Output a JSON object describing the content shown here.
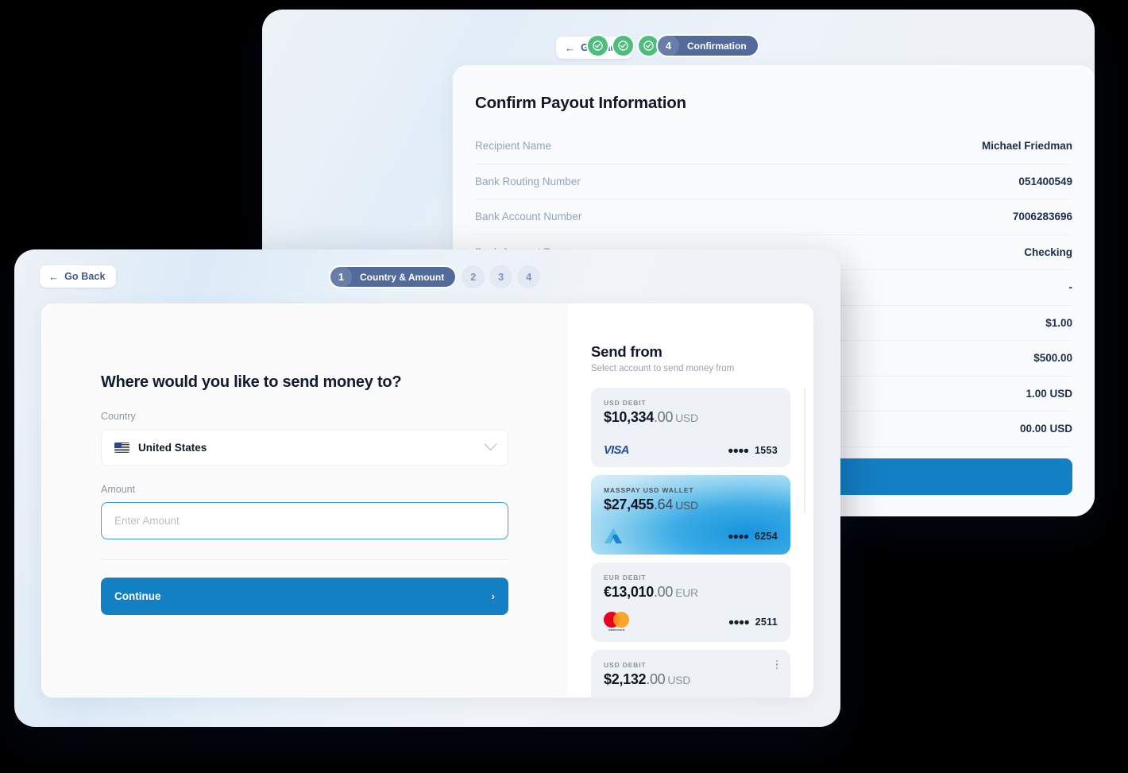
{
  "back_panel": {
    "go_back_label": "Go Back",
    "steps": [
      {
        "num": "1",
        "state": "done",
        "label": ""
      },
      {
        "num": "2",
        "state": "done",
        "label": ""
      },
      {
        "num": "3",
        "state": "done",
        "label": ""
      },
      {
        "num": "4",
        "state": "active",
        "label": "Confirmation"
      }
    ],
    "card_title": "Confirm Payout Information",
    "rows": [
      {
        "key": "Recipient Name",
        "value": "Michael Friedman"
      },
      {
        "key": "Bank Routing Number",
        "value": "051400549"
      },
      {
        "key": "Bank Account Number",
        "value": "7006283696"
      },
      {
        "key": "Bank Account Type",
        "value": "Checking"
      },
      {
        "key": "",
        "value": "-"
      },
      {
        "key": "",
        "value": "$1.00"
      },
      {
        "key": "",
        "value": "$500.00"
      },
      {
        "key": "",
        "value": "1.00 USD"
      },
      {
        "key": "",
        "value": "00.00 USD"
      }
    ]
  },
  "front_panel": {
    "go_back_label": "Go Back",
    "steps": [
      {
        "num": "1",
        "state": "active",
        "label": "Country & Amount"
      },
      {
        "num": "2",
        "state": "idle",
        "label": ""
      },
      {
        "num": "3",
        "state": "idle",
        "label": ""
      },
      {
        "num": "4",
        "state": "idle",
        "label": ""
      }
    ],
    "form": {
      "title": "Where would you like to send money to?",
      "country_label": "Country",
      "country_value": "United States",
      "country_flag": "flag-us-icon",
      "amount_label": "Amount",
      "amount_value": "",
      "amount_placeholder": "Enter Amount",
      "continue_label": "Continue"
    },
    "send_from": {
      "title": "Send from",
      "subtitle": "Select account to send money from",
      "accounts": [
        {
          "type": "USD DEBIT",
          "amount_major": "$10,334",
          "amount_minor": ".00",
          "currency": "USD",
          "brand": "visa",
          "last4": "1553",
          "selected": false,
          "has_menu": false
        },
        {
          "type": "MASSPAY USD WALLET",
          "amount_major": "$27,455",
          "amount_minor": ".64",
          "currency": "USD",
          "brand": "masspay",
          "last4": "6254",
          "selected": true,
          "has_menu": false
        },
        {
          "type": "EUR DEBIT",
          "amount_major": "€13,010",
          "amount_minor": ".00",
          "currency": "EUR",
          "brand": "mastercard",
          "last4": "2511",
          "selected": false,
          "has_menu": false
        },
        {
          "type": "USD DEBIT",
          "amount_major": "$2,132",
          "amount_minor": ".00",
          "currency": "USD",
          "brand": "none",
          "last4": "",
          "selected": false,
          "has_menu": true
        }
      ]
    }
  },
  "colors": {
    "accent_blue": "#1380c4",
    "step_done_green": "#4fbd7e",
    "step_active_slate": "#526b9b",
    "text_dark": "#11182b",
    "text_muted": "#8fa4c0"
  }
}
